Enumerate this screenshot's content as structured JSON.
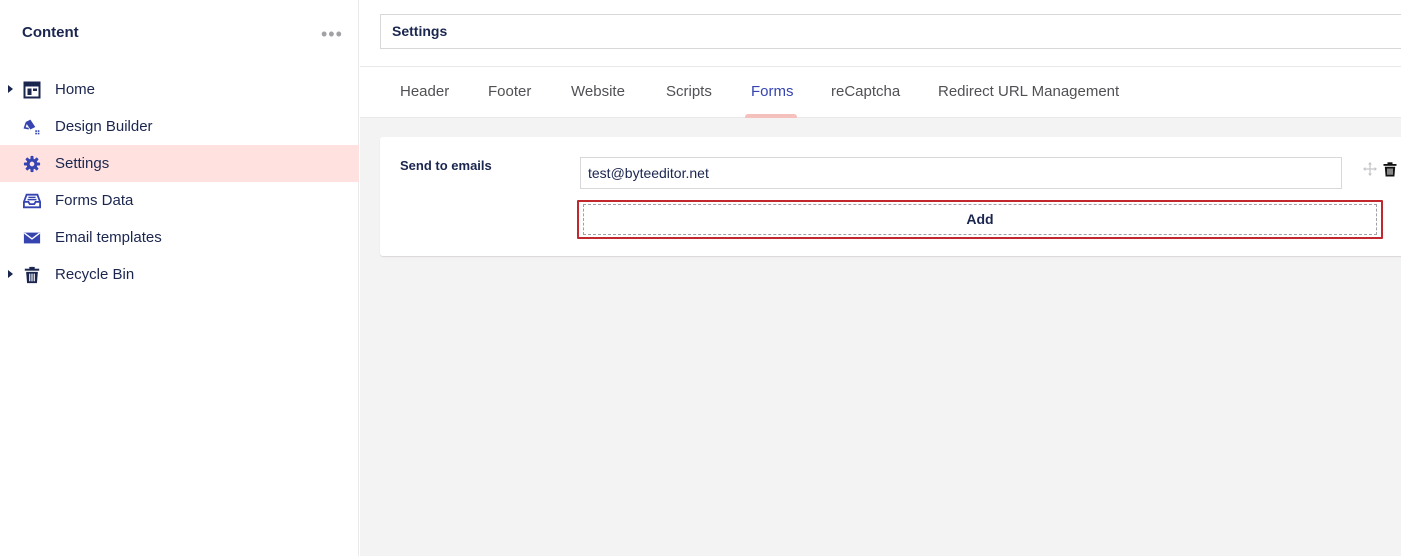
{
  "sidebar": {
    "title": "Content",
    "menu_icon": "ellipsis-icon",
    "items": [
      {
        "label": "Home",
        "icon": "layout-icon",
        "has_children": true
      },
      {
        "label": "Design Builder",
        "icon": "paint-icon",
        "has_children": false
      },
      {
        "label": "Settings",
        "icon": "gear-icon",
        "has_children": false,
        "active": true
      },
      {
        "label": "Forms Data",
        "icon": "inbox-icon",
        "has_children": false
      },
      {
        "label": "Email templates",
        "icon": "envelope-icon",
        "has_children": false
      },
      {
        "label": "Recycle Bin",
        "icon": "trash-icon",
        "has_children": true
      }
    ]
  },
  "editor": {
    "title": "Settings",
    "tabs": [
      {
        "label": "Header"
      },
      {
        "label": "Footer"
      },
      {
        "label": "Website"
      },
      {
        "label": "Scripts"
      },
      {
        "label": "Forms",
        "active": true
      },
      {
        "label": "reCaptcha"
      },
      {
        "label": "Redirect URL Management"
      }
    ],
    "property": {
      "label": "Send to emails",
      "values": [
        "test@byteeditor.net"
      ],
      "add_label": "Add"
    }
  },
  "colors": {
    "accent": "#3544b1",
    "active_bg": "#ffe2e0",
    "highlight_outline": "#c0282e",
    "text": "#1b264f"
  }
}
